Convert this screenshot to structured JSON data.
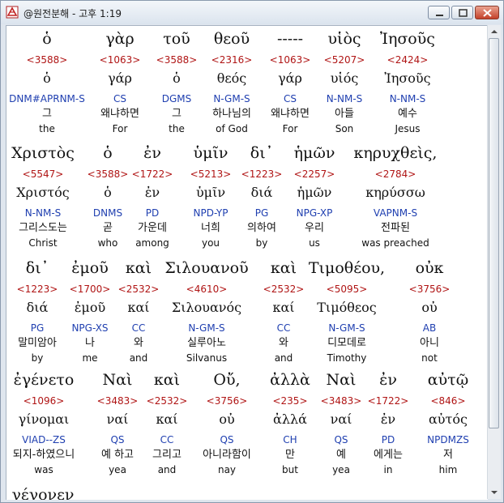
{
  "window": {
    "title": "@원전분해 - 고후 1:19",
    "buttons": {
      "minimize": "minimize",
      "maximize": "maximize",
      "close": "close"
    }
  },
  "colors": {
    "strongs": "#b01515",
    "parsing": "#1f3fb0",
    "text": "#111111"
  },
  "lines": [
    {
      "words": [
        {
          "greek": "ὁ",
          "strongs": "<3588>",
          "lemma": "ὁ",
          "parsing": "DNM#APRNM-S",
          "korean": "그",
          "english": "the"
        },
        {
          "greek": "γὰρ",
          "strongs": "<1063>",
          "lemma": "γάρ",
          "parsing": "CS",
          "korean": "왜냐하면",
          "english": "For"
        },
        {
          "greek": "τοῦ",
          "strongs": "<3588>",
          "lemma": "ὁ",
          "parsing": "DGMS",
          "korean": "그",
          "english": "the"
        },
        {
          "greek": "θεοῦ",
          "strongs": "<2316>",
          "lemma": "θεός",
          "parsing": "N-GM-S",
          "korean": "하나님의",
          "english": "of God"
        },
        {
          "greek": "-----",
          "strongs": "<1063>",
          "lemma": "γάρ",
          "parsing": "CS",
          "korean": "왜냐하면",
          "english": "For"
        },
        {
          "greek": "υἱὸς",
          "strongs": "<5207>",
          "lemma": "υἱός",
          "parsing": "N-NM-S",
          "korean": "아들",
          "english": "Son"
        },
        {
          "greek": "Ἰησοῦς",
          "strongs": "<2424>",
          "lemma": "Ἰησοῦς",
          "parsing": "N-NM-S",
          "korean": "예수",
          "english": "Jesus"
        }
      ]
    },
    {
      "words": [
        {
          "greek": "Χριστὸς",
          "strongs": "<5547>",
          "lemma": "Χριστός",
          "parsing": "N-NM-S",
          "korean": "그리스도는",
          "english": "Christ"
        },
        {
          "greek": "ὁ",
          "strongs": "<3588>",
          "lemma": "ὁ",
          "parsing": "DNMS",
          "korean": "곧",
          "english": "who"
        },
        {
          "greek": "ἐν",
          "strongs": "<1722>",
          "lemma": "ἐν",
          "parsing": "PD",
          "korean": "가운데",
          "english": "among"
        },
        {
          "greek": "ὑμῖν",
          "strongs": "<5213>",
          "lemma": "ὑμῖν",
          "parsing": "NPD-YP",
          "korean": "너희",
          "english": "you"
        },
        {
          "greek": "δι᾽",
          "strongs": "<1223>",
          "lemma": "διά",
          "parsing": "PG",
          "korean": "의하여",
          "english": "by"
        },
        {
          "greek": "ἡμῶν",
          "strongs": "<2257>",
          "lemma": "ἡμῶν",
          "parsing": "NPG-XP",
          "korean": "우리",
          "english": "us"
        },
        {
          "greek": "κηρυχθεὶς,",
          "strongs": "<2784>",
          "lemma": "κηρύσσω",
          "parsing": "VAPNM-S",
          "korean": "전파된",
          "english": "was preached"
        }
      ]
    },
    {
      "words": [
        {
          "greek": "δι᾽",
          "strongs": "<1223>",
          "lemma": "διά",
          "parsing": "PG",
          "korean": "말미암아",
          "english": "by"
        },
        {
          "greek": "ἐμοῦ",
          "strongs": "<1700>",
          "lemma": "ἐμοῦ",
          "parsing": "NPG-XS",
          "korean": "나",
          "english": "me"
        },
        {
          "greek": "καὶ",
          "strongs": "<2532>",
          "lemma": "καί",
          "parsing": "CC",
          "korean": "와",
          "english": "and"
        },
        {
          "greek": "Σιλουανοῦ",
          "strongs": "<4610>",
          "lemma": "Σιλουανός",
          "parsing": "N-GM-S",
          "korean": "실루아노",
          "english": "Silvanus"
        },
        {
          "greek": "καὶ",
          "strongs": "<2532>",
          "lemma": "καί",
          "parsing": "CC",
          "korean": "와",
          "english": "and"
        },
        {
          "greek": "Τιμοθέου,",
          "strongs": "<5095>",
          "lemma": "Τιμόθεος",
          "parsing": "N-GM-S",
          "korean": "디모데로",
          "english": "Timothy"
        },
        {
          "greek": "οὐκ",
          "strongs": "<3756>",
          "lemma": "οὐ",
          "parsing": "AB",
          "korean": "아니",
          "english": "not"
        }
      ]
    },
    {
      "words": [
        {
          "greek": "ἐγένετο",
          "strongs": "<1096>",
          "lemma": "γίνομαι",
          "parsing": "VIAD--ZS",
          "korean": "되지-하였으니",
          "english": "was"
        },
        {
          "greek": "Ναὶ",
          "strongs": "<3483>",
          "lemma": "ναί",
          "parsing": "QS",
          "korean": "예 하고",
          "english": "yea"
        },
        {
          "greek": "καὶ",
          "strongs": "<2532>",
          "lemma": "καί",
          "parsing": "CC",
          "korean": "그리고",
          "english": "and"
        },
        {
          "greek": "Οὔ,",
          "strongs": "<3756>",
          "lemma": "οὐ",
          "parsing": "QS",
          "korean": "아니라함이",
          "english": "nay"
        },
        {
          "greek": "ἀλλὰ",
          "strongs": "<235>",
          "lemma": "ἀλλά",
          "parsing": "CH",
          "korean": "만",
          "english": "but"
        },
        {
          "greek": "Ναὶ",
          "strongs": "<3483>",
          "lemma": "ναί",
          "parsing": "QS",
          "korean": "예",
          "english": "yea"
        },
        {
          "greek": "ἐν",
          "strongs": "<1722>",
          "lemma": "ἐν",
          "parsing": "PD",
          "korean": "에게는",
          "english": "in"
        },
        {
          "greek": "αὐτῷ",
          "strongs": "<846>",
          "lemma": "αὐτός",
          "parsing": "NPDMZS",
          "korean": "저",
          "english": "him"
        }
      ]
    },
    {
      "words": [
        {
          "greek": "γέγονεν"
        }
      ]
    }
  ]
}
